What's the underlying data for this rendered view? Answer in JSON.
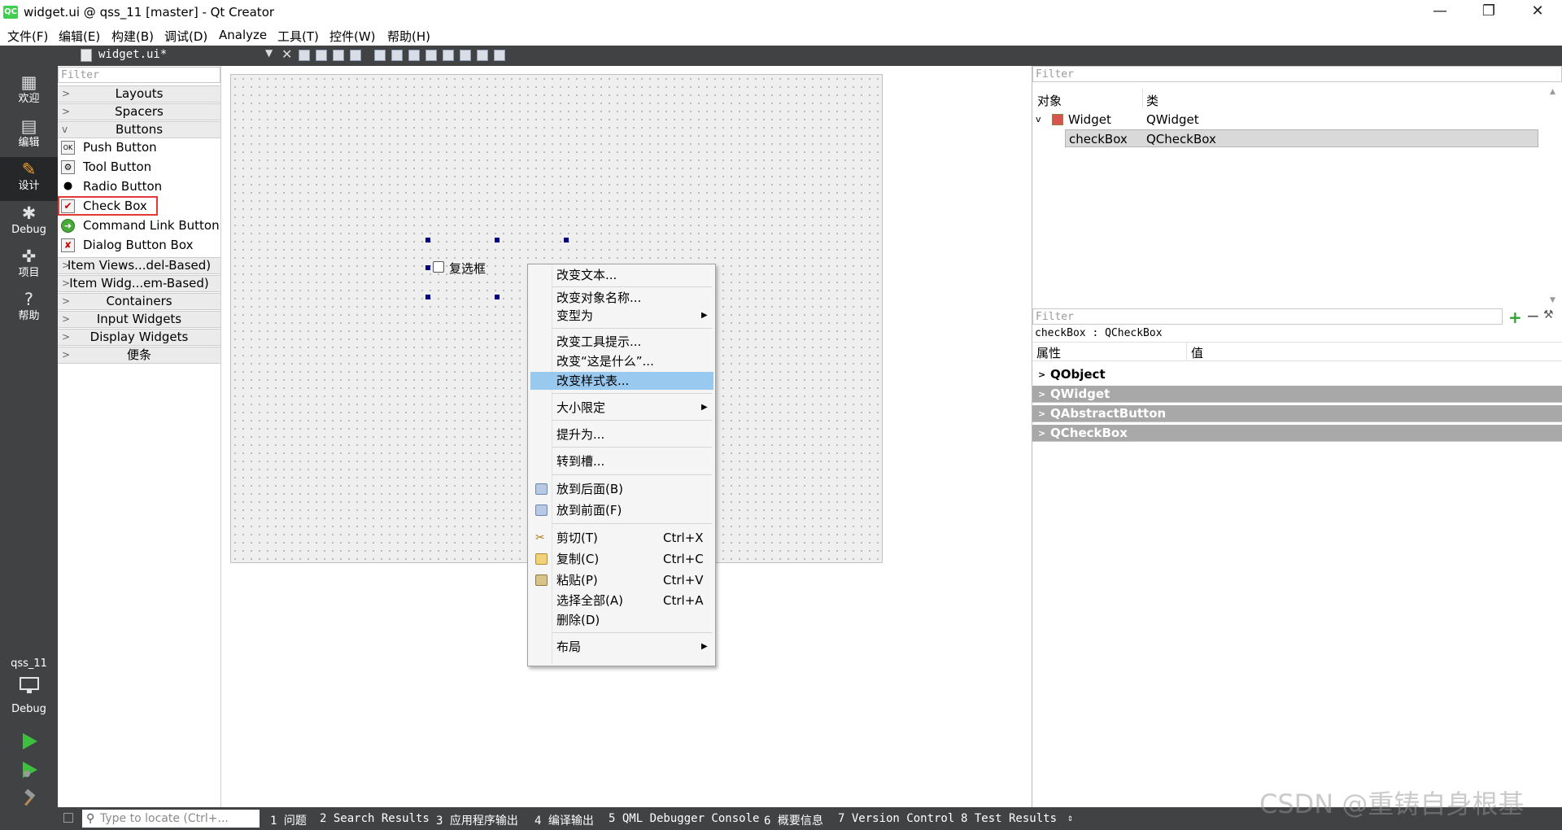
{
  "window": {
    "app_icon": "QC",
    "title": "widget.ui @ qss_11 [master] - Qt Creator",
    "min": "—",
    "restore": "❐",
    "close": "✕"
  },
  "menu": [
    "文件(F)",
    "编辑(E)",
    "构建(B)",
    "调试(D)",
    "Analyze",
    "工具(T)",
    "控件(W)",
    "帮助(H)"
  ],
  "modes": [
    {
      "label": "欢迎",
      "icon": "grid-icon",
      "glyph": "▦"
    },
    {
      "label": "编辑",
      "icon": "edit-icon",
      "glyph": "▤"
    },
    {
      "label": "设计",
      "icon": "pencil-icon",
      "glyph": "✎",
      "active": true
    },
    {
      "label": "Debug",
      "icon": "bug-icon",
      "glyph": "✱"
    },
    {
      "label": "项目",
      "icon": "wrench-icon",
      "glyph": "✜"
    },
    {
      "label": "帮助",
      "icon": "help-icon",
      "glyph": "?"
    }
  ],
  "kit": {
    "project": "qss_11",
    "config": "Debug"
  },
  "editor": {
    "file": "widget.ui*"
  },
  "widgetbox": {
    "filter_placeholder": "Filter",
    "cat_layouts": "Layouts",
    "cat_spacers": "Spacers",
    "cat_buttons": "Buttons",
    "buttons": [
      {
        "label": "Push Button",
        "icon": "push-button-icon",
        "glyph": "OK"
      },
      {
        "label": "Tool Button",
        "icon": "tool-button-icon",
        "glyph": "⚙"
      },
      {
        "label": "Radio Button",
        "icon": "radio-button-icon",
        "glyph": "●"
      },
      {
        "label": "Check Box",
        "icon": "check-box-icon",
        "glyph": "✔"
      },
      {
        "label": "Command Link Button",
        "icon": "command-link-icon",
        "glyph": "➜"
      },
      {
        "label": "Dialog Button Box",
        "icon": "dialog-button-box-icon",
        "glyph": "✘"
      }
    ],
    "cat_item_views": "Item Views...del-Based)",
    "cat_item_widgets": "Item Widg...em-Based)",
    "cat_containers": "Containers",
    "cat_input": "Input Widgets",
    "cat_display": "Display Widgets",
    "cat_misc": "便条"
  },
  "form": {
    "checkbox_text": "复选框"
  },
  "context_menu": {
    "change_text": "改变文本...",
    "change_object_name": "改变对象名称...",
    "morph_into": "变型为",
    "change_tooltip": "改变工具提示...",
    "change_whats_this": "改变“这是什么”...",
    "change_stylesheet": "改变样式表...",
    "size_constraints": "大小限定",
    "promote_to": "提升为...",
    "go_to_slot": "转到槽...",
    "send_to_back": "放到后面(B)",
    "bring_to_front": "放到前面(F)",
    "cut": "剪切(T)",
    "cut_key": "Ctrl+X",
    "copy": "复制(C)",
    "copy_key": "Ctrl+C",
    "paste": "粘贴(P)",
    "paste_key": "Ctrl+V",
    "select_all": "选择全部(A)",
    "select_all_key": "Ctrl+A",
    "delete": "删除(D)",
    "layout": "布局"
  },
  "object_inspector": {
    "filter_placeholder": "Filter",
    "col_object": "对象",
    "col_class": "类",
    "root": {
      "object": "Widget",
      "class": "QWidget"
    },
    "child": {
      "object": "checkBox",
      "class": "QCheckBox"
    }
  },
  "property_editor": {
    "filter_placeholder": "Filter",
    "context": "checkBox : QCheckBox",
    "col_property": "属性",
    "col_value": "值",
    "groups": [
      "QObject",
      "QWidget",
      "QAbstractButton",
      "QCheckBox"
    ]
  },
  "statusbar": {
    "locate_placeholder": "Type to locate (Ctrl+...",
    "panes": [
      "1 问题",
      "2 Search Results",
      "3 应用程序输出",
      "4 编译输出",
      "5 QML Debugger Console",
      "6 概要信息",
      "7 Version Control",
      "8 Test Results"
    ]
  },
  "watermark": "CSDN @重铸自身根基",
  "colors": {
    "sidebar": "#404244",
    "sidebar_active": "#262729",
    "menu_highlight": "#99c9ef",
    "selection_outline": "#e23838"
  }
}
